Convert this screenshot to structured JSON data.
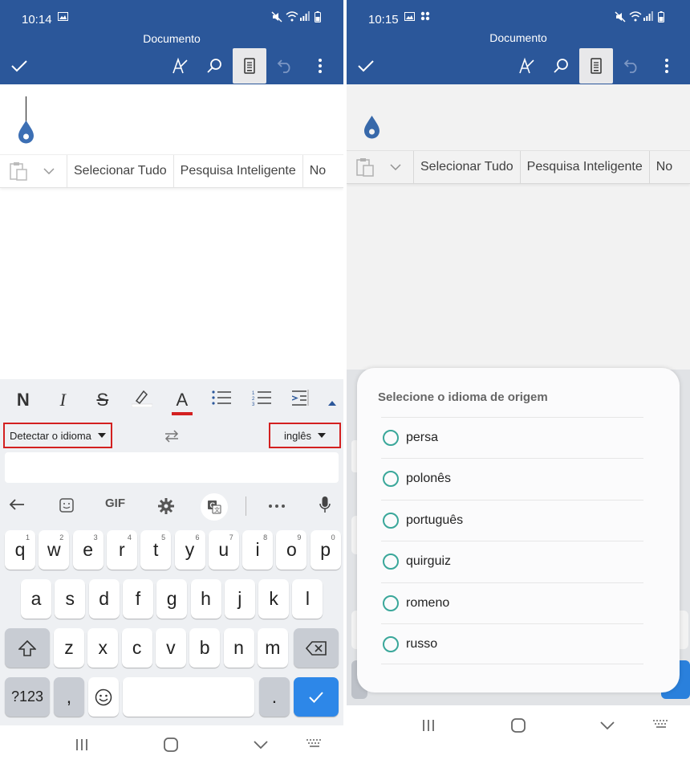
{
  "left": {
    "status": {
      "time": "10:14"
    },
    "title": "Documento",
    "context_menu": [
      "Selecionar Tudo",
      "Pesquisa Inteligente",
      "No"
    ],
    "format_bar": {
      "bold": "N",
      "italic": "I",
      "strike": "S",
      "font_color": "A"
    },
    "translate": {
      "source_label": "Detectar o idioma",
      "target_label": "inglês",
      "input_value": ""
    },
    "keyboard": {
      "toolbar_gif": "GIF",
      "row1": [
        {
          "k": "q",
          "n": "1"
        },
        {
          "k": "w",
          "n": "2"
        },
        {
          "k": "e",
          "n": "3"
        },
        {
          "k": "r",
          "n": "4"
        },
        {
          "k": "t",
          "n": "5"
        },
        {
          "k": "y",
          "n": "6"
        },
        {
          "k": "u",
          "n": "7"
        },
        {
          "k": "i",
          "n": "8"
        },
        {
          "k": "o",
          "n": "9"
        },
        {
          "k": "p",
          "n": "0"
        }
      ],
      "row2": [
        "a",
        "s",
        "d",
        "f",
        "g",
        "h",
        "j",
        "k",
        "l"
      ],
      "row3": [
        "z",
        "x",
        "c",
        "v",
        "b",
        "n",
        "m"
      ],
      "sym_label": "?123",
      "comma": ",",
      "period": "."
    }
  },
  "right": {
    "status": {
      "time": "10:15"
    },
    "title": "Documento",
    "context_menu": [
      "Selecionar Tudo",
      "Pesquisa Inteligente",
      "No"
    ],
    "dialog": {
      "title": "Selecione o idioma de origem",
      "options": [
        "persa",
        "polonês",
        "português",
        "quirguiz",
        "romeno",
        "russo"
      ]
    }
  },
  "colors": {
    "header": "#2b579a",
    "accent_blue": "#2d87e8",
    "highlight_red": "#d32020",
    "radio_teal": "#3aa79a"
  },
  "icons": [
    "check-icon",
    "pen-icon",
    "search-icon",
    "reading-mode-icon",
    "undo-icon",
    "more-icon",
    "paste-icon",
    "chevron-down-icon",
    "swap-icon",
    "back-arrow-icon",
    "sticker-icon",
    "gear-icon",
    "translate-icon",
    "mic-icon",
    "shift-icon",
    "backspace-icon",
    "emoji-icon",
    "enter-check-icon"
  ]
}
